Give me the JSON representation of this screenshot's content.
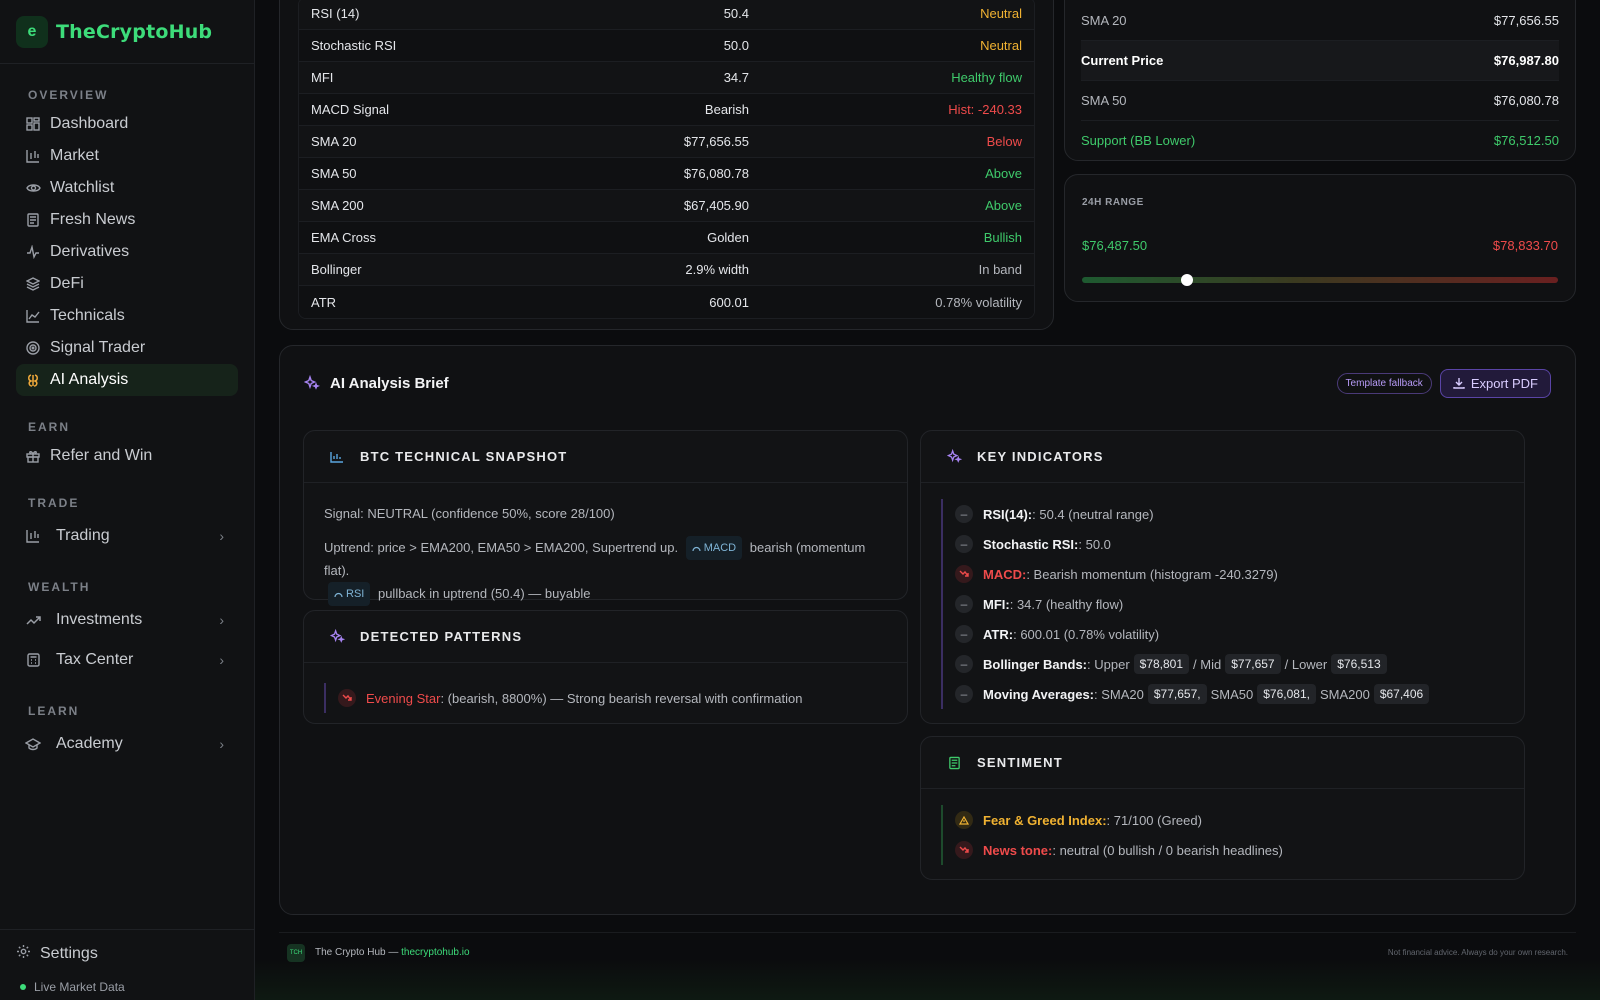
{
  "brand": {
    "logo_glyph": "e",
    "name": "TheCryptoHub"
  },
  "sidebar": {
    "overview_heading": "OVERVIEW",
    "overview_items": [
      {
        "label": "Dashboard",
        "icon": "grid-icon"
      },
      {
        "label": "Market",
        "icon": "candles-icon"
      },
      {
        "label": "Watchlist",
        "icon": "eye-icon"
      },
      {
        "label": "Fresh News",
        "icon": "newspaper-icon"
      },
      {
        "label": "Derivatives",
        "icon": "pulse-icon"
      },
      {
        "label": "DeFi",
        "icon": "layers-icon"
      },
      {
        "label": "Technicals",
        "icon": "line-chart-icon"
      },
      {
        "label": "Signal Trader",
        "icon": "target-icon"
      },
      {
        "label": "AI Analysis",
        "icon": "ai-brain-icon"
      }
    ],
    "earn_heading": "EARN",
    "refer_label": "Refer and Win",
    "trade_heading": "TRADE",
    "trading_label": "Trading",
    "wealth_heading": "WEALTH",
    "investments_label": "Investments",
    "tax_label": "Tax Center",
    "learn_heading": "LEARN",
    "academy_label": "Academy",
    "settings_label": "Settings",
    "live_label": "Live Market Data"
  },
  "indicators": [
    {
      "name": "RSI (14)",
      "value": "50.4",
      "status": "Neutral",
      "tone": "neutral"
    },
    {
      "name": "Stochastic RSI",
      "value": "50.0",
      "status": "Neutral",
      "tone": "neutral"
    },
    {
      "name": "MFI",
      "value": "34.7",
      "status": "Healthy flow",
      "tone": "green"
    },
    {
      "name": "MACD Signal",
      "value": "Bearish",
      "status": "Hist: -240.33",
      "tone": "red"
    },
    {
      "name": "SMA 20",
      "value": "$77,656.55",
      "status": "Below",
      "tone": "red"
    },
    {
      "name": "SMA 50",
      "value": "$76,080.78",
      "status": "Above",
      "tone": "green"
    },
    {
      "name": "SMA 200",
      "value": "$67,405.90",
      "status": "Above",
      "tone": "green"
    },
    {
      "name": "EMA Cross",
      "value": "Golden",
      "status": "Bullish",
      "tone": "green"
    },
    {
      "name": "Bollinger",
      "value": "2.9% width",
      "status": "In band",
      "tone": "muted"
    },
    {
      "name": "ATR",
      "value": "600.01",
      "status": "0.78% volatility",
      "tone": "muted"
    }
  ],
  "levels": {
    "sma20_label": "SMA 20",
    "sma20_value": "$77,656.55",
    "current_label": "Current Price",
    "current_value": "$76,987.80",
    "sma50_label": "SMA 50",
    "sma50_value": "$76,080.78",
    "support_label": "Support (BB Lower)",
    "support_value": "$76,512.50"
  },
  "range": {
    "title": "24H RANGE",
    "low": "$76,487.50",
    "high": "$78,833.70",
    "position": 0.22
  },
  "ai": {
    "title": "AI Analysis Brief",
    "badge": "Template fallback",
    "export_label": "Export PDF",
    "snapshot": {
      "title": "BTC TECHNICAL SNAPSHOT",
      "signal": "Signal: NEUTRAL (confidence 50%, score 28/100)",
      "line1_a": "Uptrend: price > EMA200, EMA50 > EMA200, Supertrend up.",
      "macd_tag": "MACD",
      "line1_b": "bearish (momentum flat).",
      "rsi_tag": "RSI",
      "line2": "pullback in uptrend (50.4) — buyable"
    },
    "patterns": {
      "title": "DETECTED PATTERNS",
      "name": "Evening Star",
      "desc": ": (bearish, 8800%) — Strong bearish reversal with confirmation"
    },
    "key": {
      "title": "KEY INDICATORS",
      "rsi_key": "RSI(14):",
      "rsi_val": ": 50.4 (neutral range)",
      "stoch_key": "Stochastic RSI:",
      "stoch_val": ": 50.0",
      "macd_key": "MACD:",
      "macd_val": ": Bearish momentum (histogram -240.3279)",
      "mfi_key": "MFI:",
      "mfi_val": ": 34.7 (healthy flow)",
      "atr_key": "ATR:",
      "atr_val": ": 600.01 (0.78% volatility)",
      "bb_key": "Bollinger Bands:",
      "bb_upper_label": ": Upper",
      "bb_upper": "$78,801",
      "bb_mid_label": "/ Mid",
      "bb_mid": "$77,657",
      "bb_lower_label": "/ Lower",
      "bb_lower": "$76,513",
      "ma_key": "Moving Averages:",
      "ma_20_label": ": SMA20",
      "ma_20": "$77,657,",
      "ma_50_label": "SMA50",
      "ma_50": "$76,081,",
      "ma_200_label": "SMA200",
      "ma_200": "$67,406"
    },
    "sentiment": {
      "title": "SENTIMENT",
      "fg_key": "Fear & Greed Index:",
      "fg_val": ": 71/100 (Greed)",
      "news_key": "News tone:",
      "news_val": ": neutral (0 bullish / 0 bearish headlines)"
    }
  },
  "footer": {
    "logo": "TCH",
    "text": "The Crypto Hub —",
    "link": "thecryptohub.io",
    "disclaimer": "Not financial advice. Always do your own research."
  },
  "colors": {
    "accent": "#3ddc7a",
    "bull": "#3fca6b",
    "bear": "#ef4b4b",
    "neutral": "#f0b232",
    "ai": "#a784f2"
  }
}
